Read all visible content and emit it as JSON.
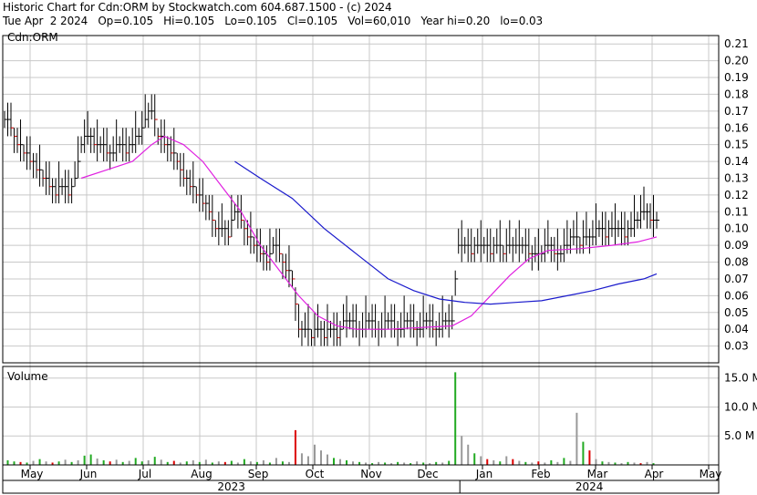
{
  "header": {
    "line1": "Historic Chart for Cdn:ORM by Stockwatch.com 604.687.1500 - (c) 2024",
    "line2": "Tue Apr  2 2024   Op=0.105   Hi=0.105   Lo=0.105   Cl=0.105   Vol=60,010   Year hi=0.20   lo=0.03"
  },
  "colors": {
    "background": "#ffffff",
    "grid": "#c8c8c8",
    "frame": "#000000",
    "price_bar": "#000000",
    "price_tick_down": "#cc0000",
    "ma_short": "#e020e0",
    "ma_long": "#1a1acc",
    "volume_up": "#22aa22",
    "volume_down": "#dd0000",
    "volume_neutral": "#999999"
  },
  "chart_data": [
    {
      "type": "ohlc",
      "symbol_label": "Cdn:ORM",
      "y_ticks": [
        "0.21",
        "0.20",
        "0.19",
        "0.18",
        "0.17",
        "0.16",
        "0.15",
        "0.14",
        "0.13",
        "0.12",
        "0.11",
        "0.10",
        "0.09",
        "0.08",
        "0.07",
        "0.06",
        "0.05",
        "0.04",
        "0.03"
      ],
      "ylim": [
        0.02,
        0.215
      ],
      "x_month_labels": [
        "May",
        "Jun",
        "Jul",
        "Aug",
        "Sep",
        "Oct",
        "Nov",
        "Dec",
        "Jan",
        "Feb",
        "Mar",
        "Apr",
        "May"
      ],
      "year_labels": [
        "2023",
        "2024"
      ],
      "price_path": [
        [
          0,
          0.165
        ],
        [
          2,
          0.16
        ],
        [
          4,
          0.15
        ],
        [
          6,
          0.145
        ],
        [
          8,
          0.14
        ],
        [
          10,
          0.135
        ],
        [
          12,
          0.13
        ],
        [
          14,
          0.125
        ],
        [
          16,
          0.12
        ],
        [
          18,
          0.125
        ],
        [
          20,
          0.12
        ],
        [
          22,
          0.13
        ],
        [
          24,
          0.15
        ],
        [
          26,
          0.155
        ],
        [
          28,
          0.15
        ],
        [
          30,
          0.15
        ],
        [
          32,
          0.145
        ],
        [
          34,
          0.145
        ],
        [
          36,
          0.15
        ],
        [
          38,
          0.145
        ],
        [
          40,
          0.15
        ],
        [
          42,
          0.155
        ],
        [
          44,
          0.165
        ],
        [
          46,
          0.17
        ],
        [
          48,
          0.155
        ],
        [
          50,
          0.15
        ],
        [
          52,
          0.145
        ],
        [
          54,
          0.14
        ],
        [
          56,
          0.13
        ],
        [
          58,
          0.125
        ],
        [
          60,
          0.12
        ],
        [
          62,
          0.115
        ],
        [
          64,
          0.11
        ],
        [
          66,
          0.1
        ],
        [
          68,
          0.1
        ],
        [
          70,
          0.095
        ],
        [
          72,
          0.11
        ],
        [
          74,
          0.105
        ],
        [
          76,
          0.095
        ],
        [
          78,
          0.09
        ],
        [
          80,
          0.085
        ],
        [
          82,
          0.08
        ],
        [
          84,
          0.09
        ],
        [
          86,
          0.085
        ],
        [
          88,
          0.075
        ],
        [
          90,
          0.07
        ],
        [
          92,
          0.04
        ],
        [
          94,
          0.04
        ],
        [
          96,
          0.035
        ],
        [
          98,
          0.04
        ],
        [
          100,
          0.035
        ],
        [
          102,
          0.04
        ],
        [
          104,
          0.035
        ],
        [
          106,
          0.045
        ],
        [
          108,
          0.045
        ],
        [
          110,
          0.04
        ],
        [
          112,
          0.04
        ],
        [
          114,
          0.045
        ],
        [
          116,
          0.04
        ],
        [
          118,
          0.04
        ],
        [
          120,
          0.045
        ],
        [
          122,
          0.04
        ],
        [
          124,
          0.04
        ],
        [
          126,
          0.045
        ],
        [
          128,
          0.04
        ],
        [
          130,
          0.04
        ],
        [
          132,
          0.045
        ],
        [
          134,
          0.04
        ],
        [
          136,
          0.04
        ],
        [
          138,
          0.045
        ],
        [
          140,
          0.045
        ],
        [
          142,
          0.09
        ],
        [
          144,
          0.09
        ],
        [
          146,
          0.085
        ],
        [
          148,
          0.09
        ],
        [
          150,
          0.09
        ],
        [
          152,
          0.085
        ],
        [
          154,
          0.09
        ],
        [
          156,
          0.085
        ],
        [
          158,
          0.09
        ],
        [
          160,
          0.09
        ],
        [
          162,
          0.09
        ],
        [
          164,
          0.085
        ],
        [
          166,
          0.085
        ],
        [
          168,
          0.085
        ],
        [
          170,
          0.09
        ],
        [
          172,
          0.085
        ],
        [
          174,
          0.085
        ],
        [
          176,
          0.09
        ],
        [
          178,
          0.095
        ],
        [
          180,
          0.09
        ],
        [
          182,
          0.095
        ],
        [
          184,
          0.095
        ],
        [
          186,
          0.1
        ],
        [
          188,
          0.095
        ],
        [
          190,
          0.1
        ],
        [
          192,
          0.1
        ],
        [
          194,
          0.095
        ],
        [
          196,
          0.1
        ],
        [
          198,
          0.105
        ],
        [
          200,
          0.11
        ],
        [
          202,
          0.105
        ],
        [
          204,
          0.105
        ]
      ],
      "ma_short_path": [
        [
          24,
          0.13
        ],
        [
          32,
          0.135
        ],
        [
          40,
          0.14
        ],
        [
          46,
          0.15
        ],
        [
          50,
          0.155
        ],
        [
          56,
          0.15
        ],
        [
          62,
          0.14
        ],
        [
          68,
          0.125
        ],
        [
          74,
          0.11
        ],
        [
          80,
          0.09
        ],
        [
          86,
          0.075
        ],
        [
          92,
          0.06
        ],
        [
          98,
          0.048
        ],
        [
          104,
          0.042
        ],
        [
          110,
          0.04
        ],
        [
          120,
          0.04
        ],
        [
          130,
          0.041
        ],
        [
          140,
          0.042
        ],
        [
          146,
          0.048
        ],
        [
          152,
          0.06
        ],
        [
          158,
          0.072
        ],
        [
          164,
          0.082
        ],
        [
          170,
          0.087
        ],
        [
          180,
          0.088
        ],
        [
          190,
          0.09
        ],
        [
          198,
          0.092
        ],
        [
          204,
          0.095
        ]
      ],
      "ma_long_path": [
        [
          72,
          0.14
        ],
        [
          80,
          0.13
        ],
        [
          90,
          0.118
        ],
        [
          100,
          0.1
        ],
        [
          110,
          0.085
        ],
        [
          120,
          0.07
        ],
        [
          128,
          0.063
        ],
        [
          136,
          0.058
        ],
        [
          144,
          0.056
        ],
        [
          152,
          0.055
        ],
        [
          160,
          0.056
        ],
        [
          168,
          0.057
        ],
        [
          176,
          0.06
        ],
        [
          184,
          0.063
        ],
        [
          192,
          0.067
        ],
        [
          200,
          0.07
        ],
        [
          204,
          0.073
        ]
      ]
    },
    {
      "type": "bar",
      "title": "Volume",
      "y_ticks": [
        "15.0 M",
        "10.0 M",
        "5.0 M"
      ],
      "ylim": [
        0,
        17
      ],
      "volume_bars": [
        [
          1,
          0.8,
          "u"
        ],
        [
          3,
          0.6,
          "u"
        ],
        [
          5,
          0.5,
          "d"
        ],
        [
          7,
          0.4,
          "u"
        ],
        [
          9,
          0.7,
          "n"
        ],
        [
          11,
          1.0,
          "u"
        ],
        [
          13,
          0.6,
          "n"
        ],
        [
          15,
          0.4,
          "d"
        ],
        [
          17,
          0.6,
          "u"
        ],
        [
          19,
          0.9,
          "n"
        ],
        [
          21,
          0.5,
          "u"
        ],
        [
          23,
          0.8,
          "n"
        ],
        [
          25,
          1.6,
          "u"
        ],
        [
          27,
          1.8,
          "u"
        ],
        [
          29,
          1.1,
          "n"
        ],
        [
          31,
          0.8,
          "u"
        ],
        [
          33,
          0.6,
          "d"
        ],
        [
          35,
          0.9,
          "n"
        ],
        [
          37,
          0.5,
          "u"
        ],
        [
          39,
          0.7,
          "n"
        ],
        [
          41,
          1.2,
          "u"
        ],
        [
          43,
          0.6,
          "u"
        ],
        [
          45,
          0.8,
          "n"
        ],
        [
          47,
          1.4,
          "u"
        ],
        [
          49,
          0.9,
          "n"
        ],
        [
          51,
          0.5,
          "u"
        ],
        [
          53,
          0.7,
          "d"
        ],
        [
          55,
          0.4,
          "n"
        ],
        [
          57,
          0.6,
          "u"
        ],
        [
          59,
          0.8,
          "n"
        ],
        [
          61,
          0.5,
          "u"
        ],
        [
          63,
          0.9,
          "n"
        ],
        [
          65,
          0.4,
          "u"
        ],
        [
          67,
          0.6,
          "n"
        ],
        [
          69,
          0.5,
          "d"
        ],
        [
          71,
          0.7,
          "u"
        ],
        [
          73,
          0.4,
          "n"
        ],
        [
          75,
          1.0,
          "u"
        ],
        [
          77,
          0.6,
          "n"
        ],
        [
          79,
          0.5,
          "u"
        ],
        [
          81,
          0.8,
          "n"
        ],
        [
          83,
          0.4,
          "u"
        ],
        [
          85,
          1.2,
          "n"
        ],
        [
          87,
          0.6,
          "u"
        ],
        [
          89,
          0.5,
          "n"
        ],
        [
          91,
          6.0,
          "d"
        ],
        [
          93,
          2.0,
          "n"
        ],
        [
          95,
          1.5,
          "n"
        ],
        [
          97,
          3.5,
          "n"
        ],
        [
          99,
          2.5,
          "n"
        ],
        [
          101,
          1.8,
          "n"
        ],
        [
          103,
          1.2,
          "u"
        ],
        [
          105,
          1.0,
          "n"
        ],
        [
          107,
          0.8,
          "u"
        ],
        [
          109,
          0.6,
          "n"
        ],
        [
          111,
          0.5,
          "u"
        ],
        [
          113,
          0.4,
          "n"
        ],
        [
          115,
          0.3,
          "u"
        ],
        [
          117,
          0.5,
          "n"
        ],
        [
          119,
          0.4,
          "u"
        ],
        [
          121,
          0.3,
          "n"
        ],
        [
          123,
          0.5,
          "u"
        ],
        [
          125,
          0.4,
          "n"
        ],
        [
          127,
          0.3,
          "u"
        ],
        [
          129,
          0.6,
          "n"
        ],
        [
          131,
          0.4,
          "u"
        ],
        [
          133,
          0.3,
          "n"
        ],
        [
          135,
          0.5,
          "u"
        ],
        [
          137,
          0.4,
          "n"
        ],
        [
          139,
          0.7,
          "u"
        ],
        [
          141,
          16.0,
          "u"
        ],
        [
          143,
          5.0,
          "n"
        ],
        [
          145,
          3.5,
          "n"
        ],
        [
          147,
          2.0,
          "u"
        ],
        [
          149,
          1.5,
          "n"
        ],
        [
          151,
          1.0,
          "d"
        ],
        [
          153,
          0.8,
          "n"
        ],
        [
          155,
          0.6,
          "u"
        ],
        [
          157,
          1.5,
          "n"
        ],
        [
          159,
          1.0,
          "d"
        ],
        [
          161,
          0.7,
          "n"
        ],
        [
          163,
          0.5,
          "u"
        ],
        [
          165,
          0.4,
          "n"
        ],
        [
          167,
          0.6,
          "d"
        ],
        [
          169,
          0.4,
          "n"
        ],
        [
          171,
          0.8,
          "u"
        ],
        [
          173,
          0.5,
          "n"
        ],
        [
          175,
          1.2,
          "u"
        ],
        [
          177,
          0.7,
          "n"
        ],
        [
          179,
          9.0,
          "n"
        ],
        [
          181,
          4.0,
          "u"
        ],
        [
          183,
          2.5,
          "d"
        ],
        [
          185,
          1.0,
          "n"
        ],
        [
          187,
          0.6,
          "u"
        ],
        [
          189,
          0.5,
          "n"
        ],
        [
          191,
          0.4,
          "u"
        ],
        [
          193,
          0.3,
          "n"
        ],
        [
          195,
          0.5,
          "u"
        ],
        [
          197,
          0.4,
          "n"
        ],
        [
          199,
          0.3,
          "d"
        ],
        [
          201,
          0.5,
          "n"
        ],
        [
          203,
          0.3,
          "u"
        ]
      ]
    }
  ]
}
